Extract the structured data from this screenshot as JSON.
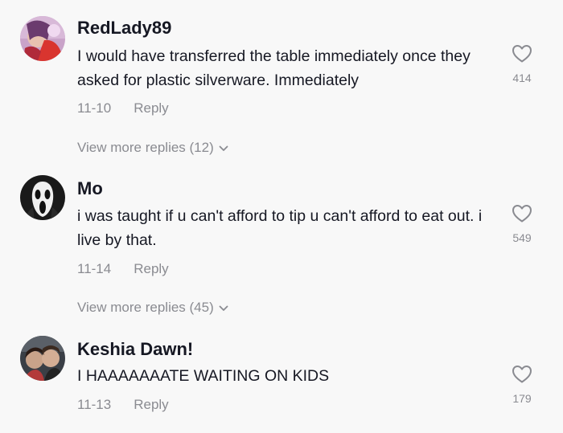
{
  "comments": [
    {
      "username": "RedLady89",
      "text": "I would have transferred the table immediately once they asked for plastic silverware. Immediately",
      "date": "11-10",
      "reply_label": "Reply",
      "likes": "414",
      "view_more": "View more replies (12)"
    },
    {
      "username": "Mo",
      "text": "i was taught if u can't afford to tip u can't afford to eat out. i live by that.",
      "date": "11-14",
      "reply_label": "Reply",
      "likes": "549",
      "view_more": "View more replies (45)"
    },
    {
      "username": "Keshia Dawn!",
      "text": "I HAAAAAAATE WAITING ON KIDS",
      "date": "11-13",
      "reply_label": "Reply",
      "likes": "179"
    }
  ],
  "colors": {
    "background": "#f8f8f8",
    "text_primary": "#161823",
    "text_secondary": "#8a8b91"
  },
  "icons": {
    "like": "heart-outline-icon",
    "expand": "chevron-down-icon"
  }
}
